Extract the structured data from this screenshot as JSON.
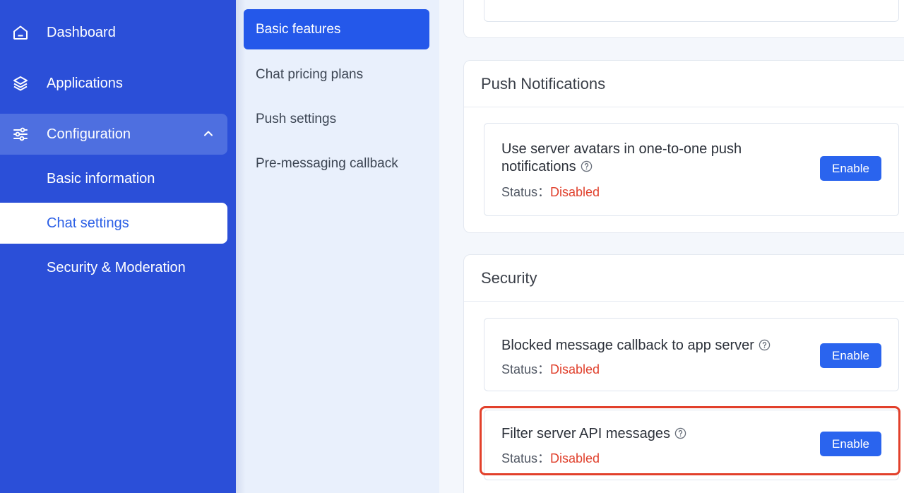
{
  "sidebar": {
    "items": [
      {
        "label": "Dashboard",
        "icon": "home-icon"
      },
      {
        "label": "Applications",
        "icon": "layers-icon"
      },
      {
        "label": "Configuration",
        "icon": "sliders-icon",
        "expanded": true
      }
    ],
    "subitems": [
      {
        "label": "Basic information"
      },
      {
        "label": "Chat settings",
        "active": true
      },
      {
        "label": "Security & Moderation"
      }
    ]
  },
  "submenu": {
    "items": [
      {
        "label": "Basic features",
        "active": true
      },
      {
        "label": "Chat pricing plans"
      },
      {
        "label": "Push settings"
      },
      {
        "label": "Pre-messaging callback"
      }
    ]
  },
  "push_section": {
    "title": "Push Notifications",
    "items": [
      {
        "title": "Use server avatars in one-to-one push notifications",
        "status_label": "Status：",
        "status_value": "Disabled",
        "button": "Enable"
      }
    ]
  },
  "security_section": {
    "title": "Security",
    "items": [
      {
        "title": "Blocked message callback to app server",
        "status_label": "Status：",
        "status_value": "Disabled",
        "button": "Enable"
      },
      {
        "title": "Filter server API messages",
        "status_label": "Status：",
        "status_value": "Disabled",
        "button": "Enable"
      }
    ]
  },
  "colors": {
    "sidebar_bg": "#2b4fd8",
    "accent": "#2458ea",
    "status_disabled": "#e0402c",
    "highlight_border": "#e2402b"
  }
}
